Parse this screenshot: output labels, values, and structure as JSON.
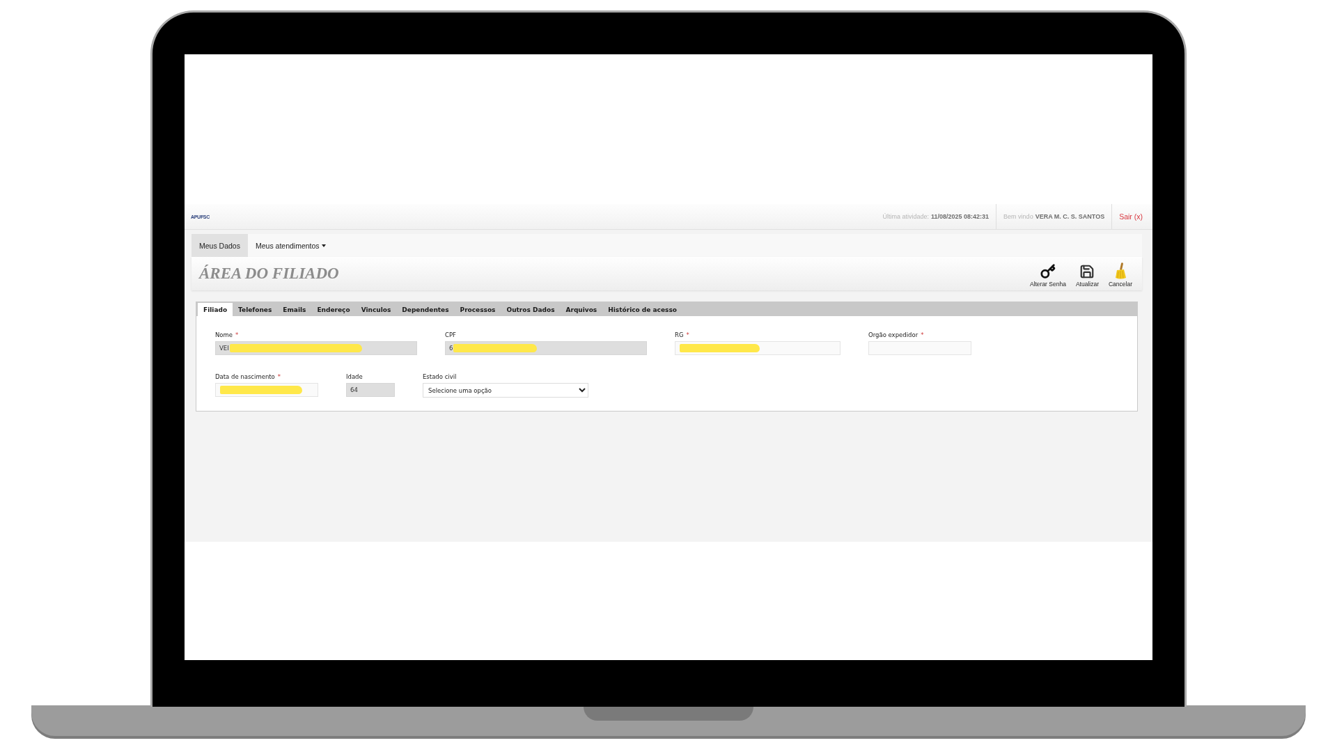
{
  "header": {
    "logo": "APUFSC",
    "last_activity_label": "Última atividade:",
    "last_activity": "11/08/2025 08:42:31",
    "welcome_label": "Bem vindo",
    "user_name": "VERA M. C. S. SANTOS",
    "logout": "Sair (x)"
  },
  "menu": [
    {
      "label": "Meus Dados",
      "selected": true,
      "dropdown": false
    },
    {
      "label": "Meus atendimentos",
      "selected": false,
      "dropdown": true
    }
  ],
  "page_title": "ÁREA DO FILIADO",
  "required_mark": "*",
  "actions": [
    {
      "label": "Alterar Senha",
      "kind": "key"
    },
    {
      "label": "Atualizar",
      "kind": "save"
    },
    {
      "label": "Cancelar",
      "kind": "broom"
    }
  ],
  "tabs": [
    {
      "label": "Filiado",
      "selected": true
    },
    {
      "label": "Telefones",
      "selected": false
    },
    {
      "label": "Emails",
      "selected": false
    },
    {
      "label": "Endereço",
      "selected": false
    },
    {
      "label": "Vinculos",
      "selected": false
    },
    {
      "label": "Dependentes",
      "selected": false
    },
    {
      "label": "Processos",
      "selected": false
    },
    {
      "label": "Outros Dados",
      "selected": false
    },
    {
      "label": "Arquivos",
      "selected": false
    },
    {
      "label": "Histórico de acesso",
      "selected": false
    }
  ],
  "form_rows": [
    [
      {
        "label": "Nome",
        "required": true,
        "kind": "text",
        "readonly": true,
        "value": "VEI",
        "redacted": true
      },
      {
        "label": "CPF",
        "required": false,
        "kind": "text",
        "readonly": true,
        "value": "6",
        "redacted": true
      },
      {
        "label": "RG",
        "required": true,
        "kind": "text",
        "readonly": false,
        "redacted": true
      },
      {
        "label": "Orgão expedidor",
        "required": true,
        "kind": "text",
        "readonly": false,
        "redacted": false
      }
    ],
    [
      {
        "label": "Data de nascimento",
        "required": true,
        "kind": "text",
        "readonly": false,
        "redacted": true
      },
      {
        "label": "Idade",
        "required": false,
        "kind": "text",
        "readonly": true,
        "value": "64",
        "redacted": false
      },
      {
        "label": "Estado civil",
        "required": false,
        "kind": "select",
        "readonly": false,
        "value": "Selecione uma opção"
      }
    ]
  ]
}
